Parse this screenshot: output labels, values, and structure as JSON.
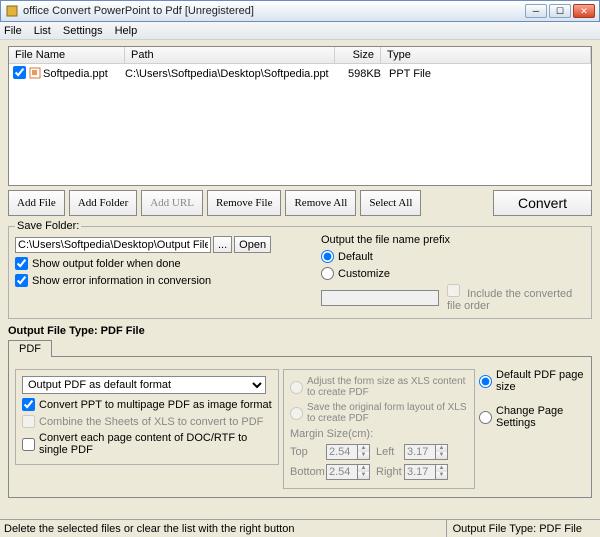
{
  "window": {
    "title": "office Convert PowerPoint to Pdf [Unregistered]"
  },
  "menu": {
    "file": "File",
    "list": "List",
    "settings": "Settings",
    "help": "Help"
  },
  "filelist": {
    "headers": {
      "name": "File Name",
      "path": "Path",
      "size": "Size",
      "type": "Type"
    },
    "rows": [
      {
        "name": "Softpedia.ppt",
        "path": "C:\\Users\\Softpedia\\Desktop\\Softpedia.ppt",
        "size": "598KB",
        "type": "PPT File",
        "checked": true
      }
    ]
  },
  "buttons": {
    "addfile": "Add File",
    "addfolder": "Add Folder",
    "addurl": "Add URL",
    "removefile": "Remove File",
    "removeall": "Remove All",
    "selectall": "Select All",
    "convert": "Convert"
  },
  "savefolder": {
    "legend": "Save Folder:",
    "path": "C:\\Users\\Softpedia\\Desktop\\Output Files",
    "browse": "...",
    "open": "Open",
    "showfolder": "Show output folder when done",
    "showerror": "Show error information in conversion",
    "prefix_title": "Output the file name prefix",
    "default": "Default",
    "customize": "Customize",
    "includeorder": "Include the converted file order"
  },
  "output": {
    "typelabel": "Output File Type:  PDF File",
    "tab": "PDF",
    "select_val": "Output PDF as default format",
    "convert_ppt": "Convert PPT to multipage PDF as image format",
    "combine_xls": "Combine the Sheets of XLS to convert to PDF",
    "convert_doc": "Convert each page content of DOC/RTF to single PDF",
    "adjust_xls": "Adjust the form size as XLS content to create PDF",
    "save_layout": "Save the original form layout of XLS to create PDF",
    "margin_label": "Margin Size(cm):",
    "top": "Top",
    "left": "Left",
    "bottom": "Bottom",
    "right": "Right",
    "top_v": "2.54",
    "left_v": "3.17",
    "bottom_v": "2.54",
    "right_v": "3.17",
    "default_page": "Default PDF page size",
    "change_page": "Change Page Settings"
  },
  "status": {
    "left": "Delete the selected files or clear the list with the right button",
    "right": "Output File Type:  PDF File"
  }
}
